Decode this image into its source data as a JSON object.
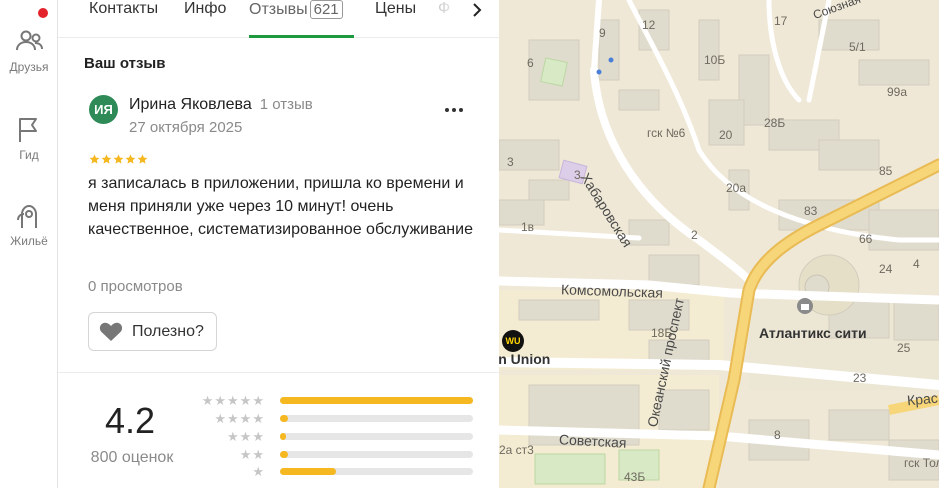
{
  "rail": {
    "items": [
      {
        "label": "Друзья",
        "icon": "friends-icon"
      },
      {
        "label": "Гид",
        "icon": "flag-icon"
      },
      {
        "label": "Жильё",
        "icon": "housing-icon"
      }
    ]
  },
  "tabs": {
    "items": [
      "Контакты",
      "Инфо",
      "Отзывы",
      "Цены",
      "Ф"
    ],
    "reviews_count": "621",
    "active": "Отзывы"
  },
  "review": {
    "section_title": "Ваш отзыв",
    "avatar_initials": "ИЯ",
    "author": "Ирина Яковлева",
    "author_reviews": "1 отзыв",
    "date": "27 октября 2025",
    "stars": 5,
    "text": "я записалась в приложении, пришла ко времени и меня приняли уже через 10 минут! очень качественное, систематизированное обслуживание",
    "views": "0 просмотров",
    "useful_label": "Полезно?"
  },
  "rating": {
    "value": "4.2",
    "count_label": "800 оценок",
    "distribution": [
      {
        "stars": 5,
        "fraction": 1.0
      },
      {
        "stars": 4,
        "fraction": 0.04
      },
      {
        "stars": 3,
        "fraction": 0.02
      },
      {
        "stars": 2,
        "fraction": 0.04
      },
      {
        "stars": 1,
        "fraction": 0.29
      }
    ]
  },
  "map": {
    "streets": [
      "Хабаровская",
      "Комсомольская",
      "Океанский проспект",
      "Советская",
      "Крас"
    ],
    "poi": [
      "Атлантикс сити",
      "ern Union"
    ],
    "house_numbers": [
      "12",
      "9",
      "6",
      "10Б",
      "17",
      "Союзная",
      "5/1",
      "99а",
      "28Б",
      "гск №6",
      "20",
      "3",
      "85",
      "20а",
      "83",
      "1в",
      "2",
      "66",
      "4",
      "24",
      "18Б",
      "25",
      "23",
      "3",
      "2а ст3",
      "43Б",
      "гск Тол",
      "8"
    ]
  },
  "colors": {
    "accent_green": "#1d9a3e",
    "star_yellow": "#f5b820",
    "notification_red": "#e3242b",
    "avatar_green": "#2e8b57"
  }
}
